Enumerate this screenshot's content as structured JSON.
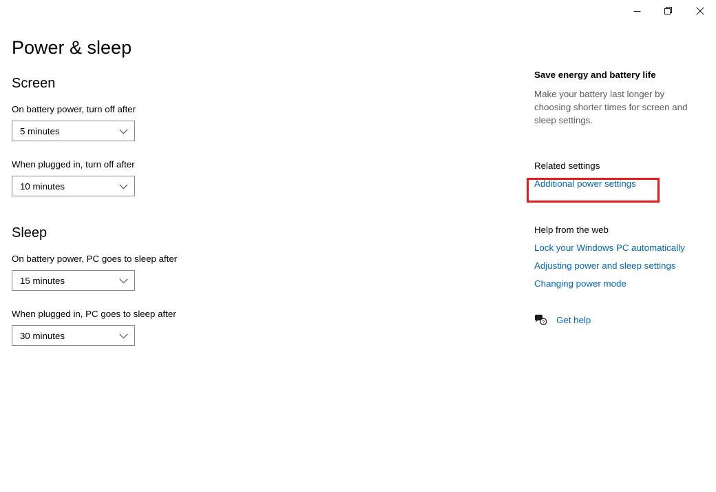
{
  "window": {
    "controls": [
      {
        "name": "minimize",
        "label": "Minimize",
        "glyph": "minimize-icon"
      },
      {
        "name": "restore",
        "label": "Restore Down",
        "glyph": "restore-icon"
      },
      {
        "name": "close",
        "label": "Close",
        "glyph": "close-icon"
      }
    ]
  },
  "page": {
    "title": "Power & sleep"
  },
  "screen": {
    "heading": "Screen",
    "fields": [
      {
        "label": "On battery power, turn off after",
        "value": "5 minutes",
        "chevron": "chevron-down-icon"
      },
      {
        "label": "When plugged in, turn off after",
        "value": "10 minutes",
        "chevron": "chevron-down-icon"
      }
    ]
  },
  "sleep": {
    "heading": "Sleep",
    "fields": [
      {
        "label": "On battery power, PC goes to sleep after",
        "value": "15 minutes",
        "chevron": "chevron-down-icon"
      },
      {
        "label": "When plugged in, PC goes to sleep after",
        "value": "30 minutes",
        "chevron": "chevron-down-icon"
      }
    ]
  },
  "aside": {
    "save_energy": {
      "heading": "Save energy and battery life",
      "body": "Make your battery last longer by choosing shorter times for screen and sleep settings."
    },
    "related": {
      "heading": "Related settings",
      "links": [
        {
          "label": "Additional power settings",
          "highlighted": true
        }
      ]
    },
    "help_web": {
      "heading": "Help from the web",
      "links": [
        {
          "label": "Lock your Windows PC automatically"
        },
        {
          "label": "Adjusting power and sleep settings"
        },
        {
          "label": "Changing power mode"
        }
      ]
    },
    "get_help": {
      "label": "Get help",
      "icon": "help-bubble-icon"
    }
  },
  "colors": {
    "link": "#0067c0",
    "highlight_border": "#e8191b",
    "body_text": "#000000",
    "muted_text": "#5a5a5a",
    "combo_border": "#8a8a8a"
  }
}
